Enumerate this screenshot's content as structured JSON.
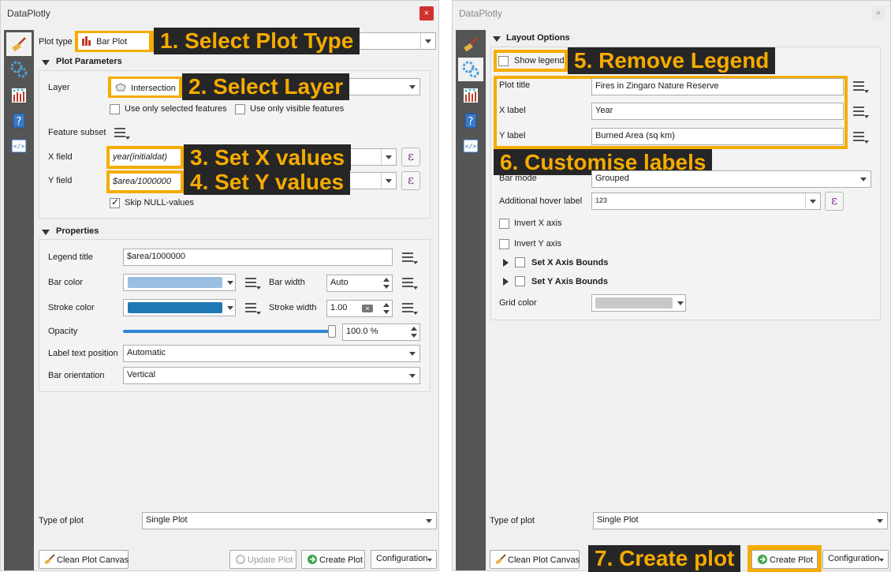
{
  "left_window": {
    "title": "DataPlotly",
    "close_label": "×",
    "plot_type_label": "Plot type",
    "plot_type_value": "Bar Plot",
    "plot_parameters_heading": "Plot Parameters",
    "layer_label": "Layer",
    "layer_value": "Intersection",
    "use_selected_label": "Use only selected features",
    "use_visible_label": "Use only visible features",
    "feature_subset_label": "Feature subset",
    "x_field_label": "X field",
    "x_field_value": "year(initialdat)",
    "y_field_label": "Y field",
    "y_field_value": "$area/1000000",
    "skip_null_label": "Skip NULL-values",
    "properties_heading": "Properties",
    "legend_title_label": "Legend title",
    "legend_title_value": "$area/1000000",
    "bar_color_label": "Bar color",
    "bar_width_label": "Bar width",
    "bar_width_value": "Auto",
    "stroke_color_label": "Stroke color",
    "stroke_width_label": "Stroke width",
    "stroke_width_value": "1.00",
    "opacity_label": "Opacity",
    "opacity_value": "100.0 %",
    "opacity_level": 1.0,
    "label_text_position_label": "Label text position",
    "label_text_position_value": "Automatic",
    "bar_orientation_label": "Bar orientation",
    "bar_orientation_value": "Vertical",
    "type_of_plot_label": "Type of plot",
    "type_of_plot_value": "Single Plot",
    "clean_canvas_label": "Clean Plot Canvas",
    "update_plot_label": "Update Plot",
    "create_plot_label": "Create Plot",
    "configuration_label": "Configuration",
    "bar_color_hex": "#9bbfe0",
    "stroke_color_hex": "#1f78b4"
  },
  "right_window": {
    "title": "DataPlotly",
    "close_label": "×",
    "layout_options_heading": "Layout Options",
    "show_legend_label": "Show legend",
    "plot_title_label": "Plot title",
    "plot_title_value": "Fires in Zingaro Nature Reserve",
    "x_label_label": "X label",
    "x_label_value": "Year",
    "y_label_label": "Y label",
    "y_label_value": "Burned Area (sq km)",
    "bar_mode_label": "Bar mode",
    "bar_mode_value": "Grouped",
    "hover_label_label": "Additional hover label",
    "hover_label_value": "123",
    "invert_x_label": "Invert X axis",
    "invert_y_label": "Invert Y axis",
    "x_bounds_label": "Set X Axis Bounds",
    "y_bounds_label": "Set Y Axis Bounds",
    "grid_color_label": "Grid color",
    "grid_color_hex": "#c8c8c8",
    "type_of_plot_label": "Type of plot",
    "type_of_plot_value": "Single Plot",
    "clean_canvas_label": "Clean Plot Canvas",
    "create_plot_label": "Create Plot",
    "configuration_label": "Configuration"
  },
  "callouts": {
    "step1": "1. Select Plot Type",
    "step2": "2. Select Layer",
    "step3": "3. Set X values",
    "step4": "4. Set Y values",
    "step5": "5. Remove Legend",
    "step6": "6. Customise labels",
    "step7": "7. Create plot"
  },
  "colors": {
    "callout_accent": "#f6ab00",
    "callout_dark": "#262626",
    "sidebar": "#555555"
  }
}
